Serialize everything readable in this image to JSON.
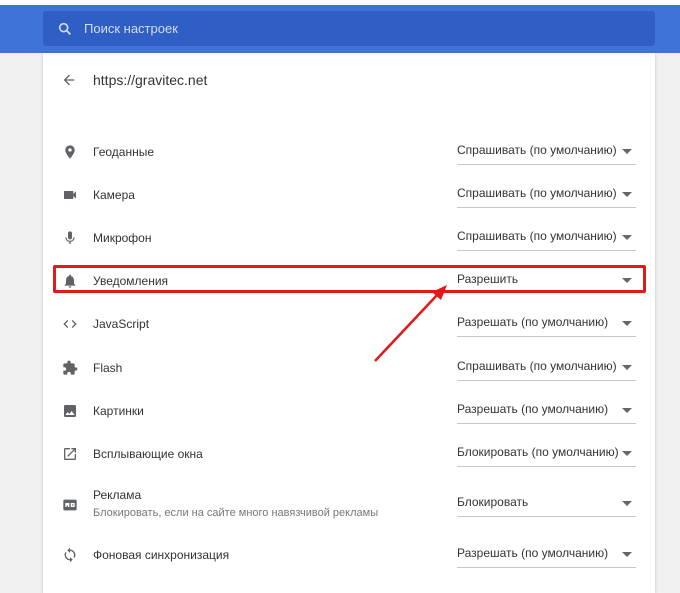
{
  "search": {
    "placeholder": "Поиск настроек"
  },
  "site": {
    "url": "https://gravitec.net"
  },
  "permissions": [
    {
      "label": "Геоданные",
      "value": "Спрашивать (по умолчанию)",
      "icon": "location-icon"
    },
    {
      "label": "Камера",
      "value": "Спрашивать (по умолчанию)",
      "icon": "camera-icon"
    },
    {
      "label": "Микрофон",
      "value": "Спрашивать (по умолчанию)",
      "icon": "microphone-icon"
    },
    {
      "label": "Уведомления",
      "value": "Разрешить",
      "icon": "bell-icon"
    },
    {
      "label": "JavaScript",
      "value": "Разрешать (по умолчанию)",
      "icon": "code-icon"
    },
    {
      "label": "Flash",
      "value": "Спрашивать (по умолчанию)",
      "icon": "puzzle-icon"
    },
    {
      "label": "Картинки",
      "value": "Разрешать (по умолчанию)",
      "icon": "image-icon"
    },
    {
      "label": "Всплывающие окна",
      "value": "Блокировать (по умолчанию)",
      "icon": "open-in-new-icon"
    },
    {
      "label": "Реклама",
      "sublabel": "Блокировать, если на сайте много навязчивой рекламы",
      "value": "Блокировать",
      "icon": "ads-icon"
    },
    {
      "label": "Фоновая синхронизация",
      "value": "Разрешать (по умолчанию)",
      "icon": "sync-icon"
    }
  ],
  "colors": {
    "header": "#3f73d8",
    "search_bg": "#2f5fc4",
    "highlight": "#e11919"
  }
}
